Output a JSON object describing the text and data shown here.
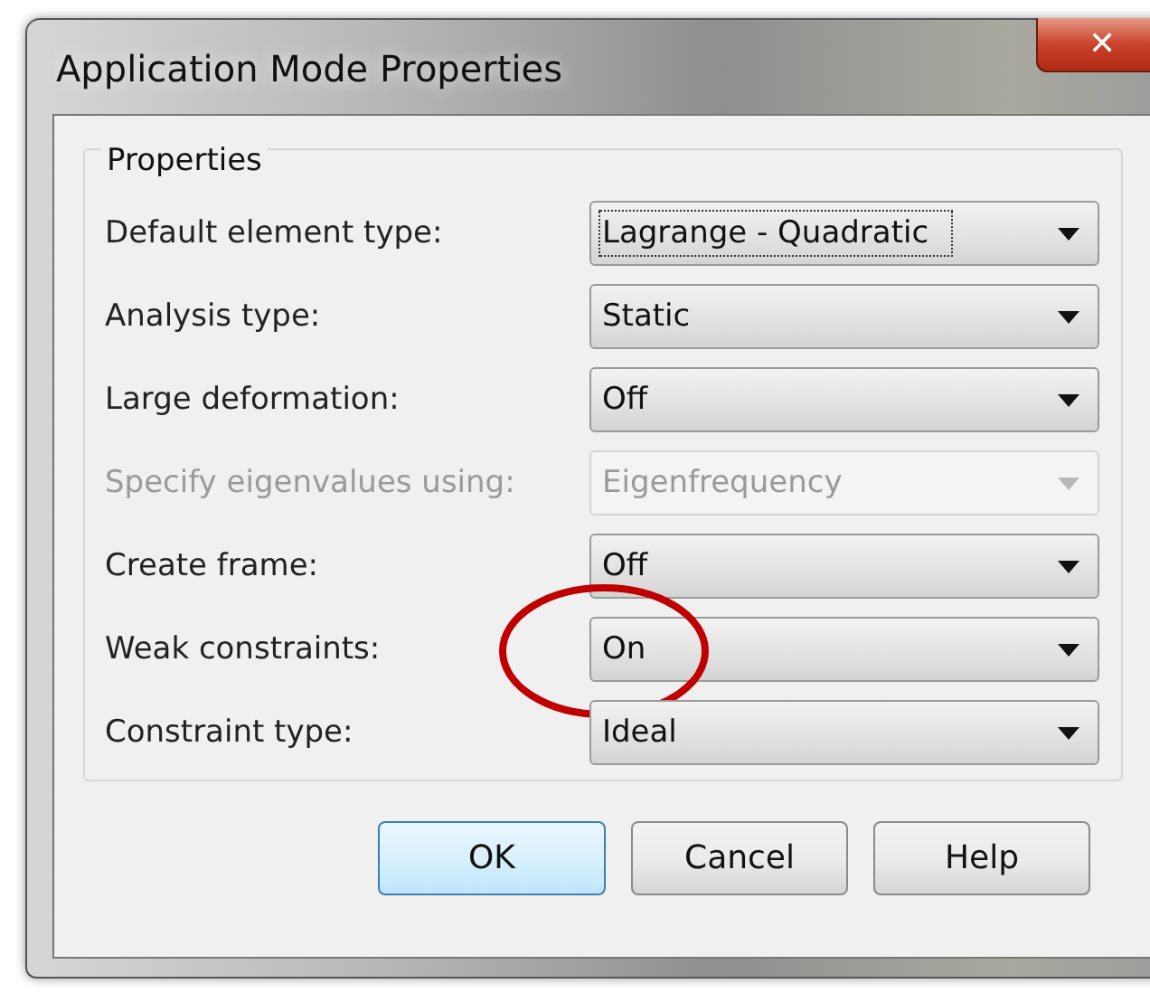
{
  "window": {
    "title": "Application Mode Properties",
    "close": "✕"
  },
  "group": {
    "title": "Properties",
    "rows": [
      {
        "label": "Default element type:",
        "value": "Lagrange - Quadratic",
        "disabled": false,
        "focused": true,
        "circled": false
      },
      {
        "label": "Analysis type:",
        "value": "Static",
        "disabled": false,
        "focused": false,
        "circled": false
      },
      {
        "label": "Large deformation:",
        "value": "Off",
        "disabled": false,
        "focused": false,
        "circled": false
      },
      {
        "label": "Specify eigenvalues using:",
        "value": "Eigenfrequency",
        "disabled": true,
        "focused": false,
        "circled": false
      },
      {
        "label": "Create frame:",
        "value": "Off",
        "disabled": false,
        "focused": false,
        "circled": false
      },
      {
        "label": "Weak constraints:",
        "value": "On",
        "disabled": false,
        "focused": false,
        "circled": true
      },
      {
        "label": "Constraint type:",
        "value": "Ideal",
        "disabled": false,
        "focused": false,
        "circled": false
      }
    ]
  },
  "buttons": [
    {
      "label": "OK",
      "default": true
    },
    {
      "label": "Cancel",
      "default": false
    },
    {
      "label": "Help",
      "default": false
    }
  ]
}
